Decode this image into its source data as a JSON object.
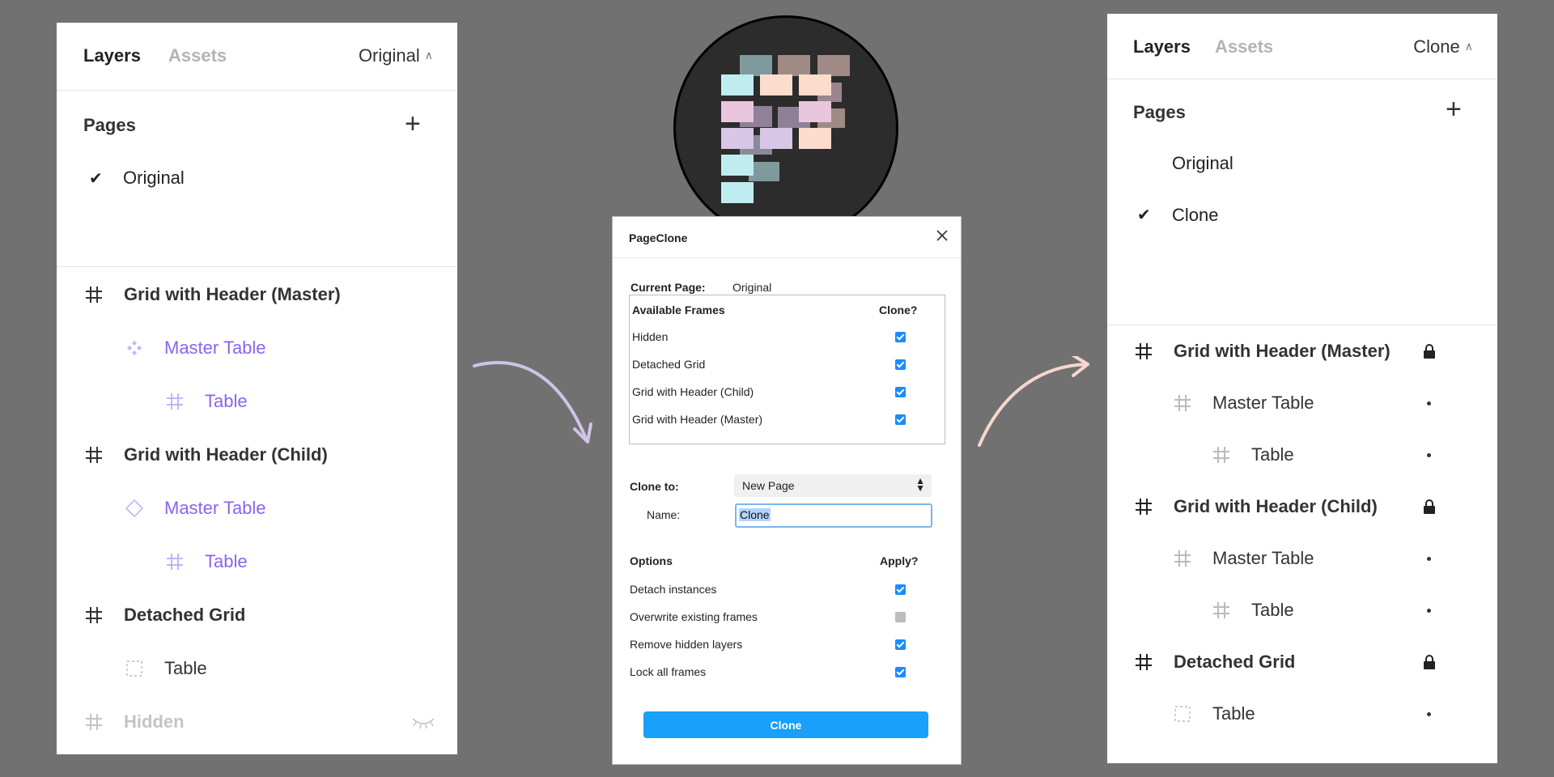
{
  "left_panel": {
    "tabs": {
      "layers": "Layers",
      "assets": "Assets",
      "page": "Original"
    },
    "pages_label": "Pages",
    "pages": [
      {
        "name": "Original",
        "checked": true
      }
    ],
    "layers": [
      {
        "name": "Grid with Header (Master)",
        "icon": "frame-icon",
        "indent": 0
      },
      {
        "name": "Master Table",
        "icon": "component-icon",
        "indent": 1
      },
      {
        "name": "Table",
        "icon": "frame-icon",
        "indent": 2
      },
      {
        "name": "Grid with Header (Child)",
        "icon": "frame-icon",
        "indent": 0
      },
      {
        "name": "Master Table",
        "icon": "instance-icon",
        "indent": 1
      },
      {
        "name": "Table",
        "icon": "frame-icon",
        "indent": 2
      },
      {
        "name": "Detached Grid",
        "icon": "frame-icon",
        "indent": 0
      },
      {
        "name": "Table",
        "icon": "group-icon",
        "indent": 1
      },
      {
        "name": "Hidden",
        "icon": "frame-icon",
        "indent": 0
      }
    ]
  },
  "dialog": {
    "title": "PageClone",
    "current_page_label": "Current Page:",
    "current_page_value": "Original",
    "frames_header": "Available Frames",
    "clone_header": "Clone?",
    "frames": [
      {
        "name": "Hidden",
        "checked": true
      },
      {
        "name": "Detached Grid",
        "checked": true
      },
      {
        "name": "Grid with Header (Child)",
        "checked": true
      },
      {
        "name": "Grid with Header (Master)",
        "checked": true
      }
    ],
    "clone_to_label": "Clone to:",
    "clone_to_value": "New Page",
    "name_label": "Name:",
    "name_value": "Clone",
    "options_header": "Options",
    "apply_header": "Apply?",
    "options": [
      {
        "name": "Detach instances",
        "checked": true
      },
      {
        "name": "Overwrite existing frames",
        "checked": false
      },
      {
        "name": "Remove hidden layers",
        "checked": true
      },
      {
        "name": "Lock all frames",
        "checked": true
      }
    ],
    "button_label": "Clone"
  },
  "right_panel": {
    "tabs": {
      "layers": "Layers",
      "assets": "Assets",
      "page": "Clone"
    },
    "pages_label": "Pages",
    "pages": [
      {
        "name": "Original",
        "checked": false
      },
      {
        "name": "Clone",
        "checked": true
      }
    ],
    "layers": [
      {
        "name": "Grid with Header (Master)",
        "icon": "frame-icon",
        "indent": 0,
        "status": "locked"
      },
      {
        "name": "Master Table",
        "icon": "frame-icon",
        "indent": 1,
        "status": "dot"
      },
      {
        "name": "Table",
        "icon": "frame-icon",
        "indent": 2,
        "status": "dot"
      },
      {
        "name": "Grid with Header (Child)",
        "icon": "frame-icon",
        "indent": 0,
        "status": "locked"
      },
      {
        "name": "Master Table",
        "icon": "frame-icon",
        "indent": 1,
        "status": "dot"
      },
      {
        "name": "Table",
        "icon": "frame-icon",
        "indent": 2,
        "status": "dot"
      },
      {
        "name": "Detached Grid",
        "icon": "frame-icon",
        "indent": 0,
        "status": "locked"
      },
      {
        "name": "Table",
        "icon": "group-icon",
        "indent": 1,
        "status": "dot"
      }
    ]
  },
  "colors": {
    "background": "#717171",
    "component_purple": "#8a63f1",
    "primary_blue": "#18a0fb",
    "arrow_left": "#cfc3e6",
    "arrow_right": "#f7d6cc"
  }
}
